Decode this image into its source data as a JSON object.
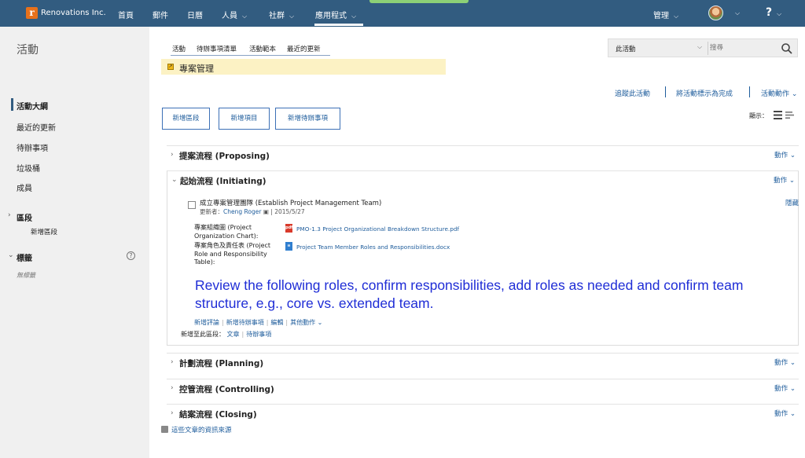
{
  "topbar": {
    "brand": "Renovations Inc.",
    "brand_initial": "r",
    "nav": [
      "首頁",
      "郵件",
      "日曆",
      "人員",
      "社群",
      "應用程式"
    ],
    "admin": "管理",
    "help": "?",
    "colors": {
      "bar": "#325c80",
      "accent": "#8cd076",
      "logo": "#e7711b"
    }
  },
  "sidebar": {
    "title": "活動",
    "items": [
      "活動大綱",
      "最近的更新",
      "待辦事項",
      "垃圾桶",
      "成員"
    ],
    "sections_label": "區段",
    "add_section": "新增區段",
    "tags_label": "標籤",
    "no_tags": "無標籤"
  },
  "main": {
    "tabs": [
      "活動",
      "待辦事項清單",
      "活動範本",
      "最近的更新"
    ],
    "activity_title": "專案管理",
    "search": {
      "scope": "此活動",
      "placeholder": "搜尋"
    },
    "actions": [
      "追蹤此活動",
      "將活動標示為完成",
      "活動動作"
    ],
    "buttons": [
      "新增區段",
      "新增項目",
      "新增待辦事項"
    ],
    "display_label": "顯示：",
    "action_label": "動作",
    "sections": [
      {
        "title": "提案流程 (Proposing)",
        "expanded": false
      },
      {
        "title": "起始流程 (Initiating)",
        "expanded": true
      },
      {
        "title": "計劃流程 (Planning)",
        "expanded": false
      },
      {
        "title": "控管流程 (Controlling)",
        "expanded": false
      },
      {
        "title": "結案流程 (Closing)",
        "expanded": false
      }
    ],
    "todo": {
      "title": "成立專案管理團隊 (Establish Project Management Team)",
      "updated_prefix": "更新者：",
      "updated_by": "Cheng Roger",
      "updated_date": "| 2015/5/27",
      "hide": "隱藏",
      "fields": [
        {
          "label": "專案組織圖 (Project Organization Chart):",
          "file": "PMO-1.3 Project Organizational Breakdown Structure.pdf",
          "type": "pdf"
        },
        {
          "label": "專案角色及責任表 (Project Role and Responsibility Table):",
          "file": "Project Team Member Roles and Responsibilities.docx",
          "type": "docx"
        }
      ],
      "note": "Review the following roles, confirm responsibilities, add roles as needed and confirm team structure, e.g., core vs. extended team.",
      "links": [
        "新增評論",
        "新增待辦事項",
        "編輯",
        "其他動作"
      ],
      "add_to_label": "新增至此區段：",
      "add_to_links": [
        "文章",
        "待辦事項"
      ]
    },
    "rss_link": "這些文章的資訊來源"
  }
}
